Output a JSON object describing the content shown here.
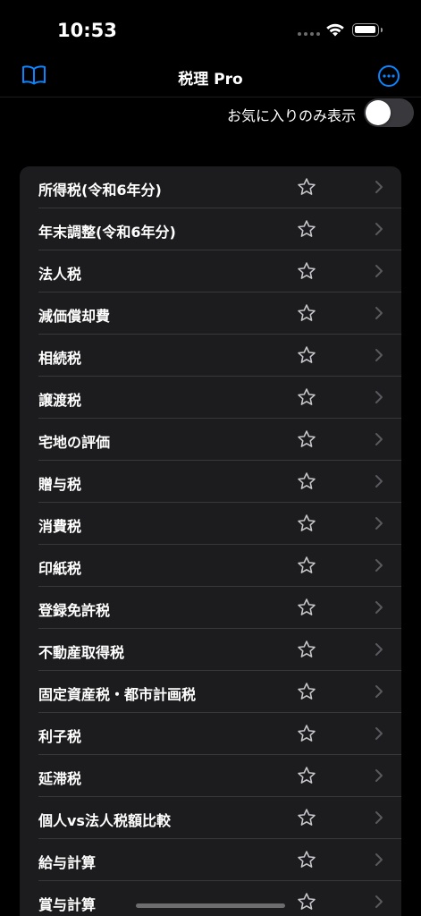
{
  "status_bar": {
    "time": "10:53",
    "icons": [
      "cellular-dots-icon",
      "wifi-icon",
      "battery-icon"
    ]
  },
  "nav": {
    "title": "税理 Pro",
    "left_icon": "book-icon",
    "right_icon": "ellipsis-circle-icon",
    "accent_color": "#0a84ff"
  },
  "favorites_filter": {
    "label": "お気に入りのみ表示",
    "toggle_on": false
  },
  "list": {
    "items": [
      {
        "label": "所得税(令和6年分)"
      },
      {
        "label": "年末調整(令和6年分)"
      },
      {
        "label": "法人税"
      },
      {
        "label": "減価償却費"
      },
      {
        "label": "相続税"
      },
      {
        "label": "譲渡税"
      },
      {
        "label": "宅地の評価"
      },
      {
        "label": "贈与税"
      },
      {
        "label": "消費税"
      },
      {
        "label": "印紙税"
      },
      {
        "label": "登録免許税"
      },
      {
        "label": "不動産取得税"
      },
      {
        "label": "固定資産税・都市計画税"
      },
      {
        "label": "利子税"
      },
      {
        "label": "延滞税"
      },
      {
        "label": "個人vs法人税額比較"
      },
      {
        "label": "給与計算"
      },
      {
        "label": "賞与計算"
      }
    ]
  },
  "colors": {
    "background": "#000000",
    "cell_background": "#1c1c1e",
    "star_outline": "#c7c7cc",
    "chevron": "#5a5a5e"
  }
}
